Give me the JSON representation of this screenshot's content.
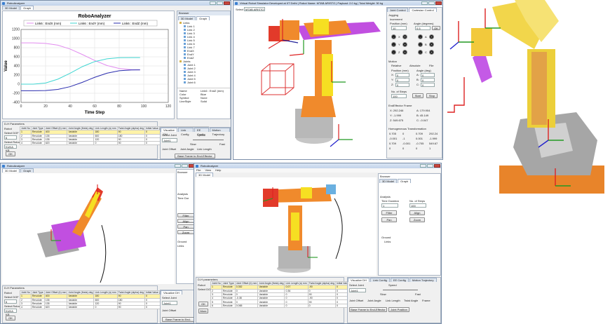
{
  "win1": {
    "title": "RoboAnalyzer",
    "tabs": [
      "3D Model",
      "Graph"
    ],
    "browser": {
      "title": "Browser",
      "tabs": [
        "3D Model",
        "Graph"
      ],
      "tree": [
        "Links",
        "Link 1",
        "Link 2",
        "Link 3",
        "Link 4",
        "Link 5",
        "Link 6",
        "Link 7",
        "EndX",
        "EndY",
        "EndZ",
        "Joints",
        "Joint 1",
        "Joint 2",
        "Joint 3",
        "Joint 4",
        "Joint 5",
        "Joint 6"
      ],
      "props": [
        [
          "Name",
          "Link6 : EndZ (mm)"
        ],
        [
          "Color",
          "Blue"
        ],
        [
          "Symbol",
          "None"
        ],
        [
          "LineStyle",
          "Solid"
        ]
      ]
    },
    "params": {
      "title": "D-H Parameters",
      "robot_label": "Robot",
      "select_dof_label": "Select DOF",
      "select_robot_label": "Select Robot",
      "robot_value": "KUKA KR",
      "dof_value": "6",
      "ok_label": "OK",
      "headers": [
        "Joint No",
        "Joint Type",
        "Joint Offset (b) mm",
        "Joint Angle (theta) deg",
        "Link Length (a) mm",
        "Twist Angle (alpha) deg",
        "Initial Value (JV) deg or mm",
        "Final Value (JV) deg or mm"
      ],
      "rows": [
        [
          "1",
          "Revolute",
          "400",
          "Variable",
          "180",
          "90",
          "0",
          "60"
        ],
        [
          "2",
          "Revolute",
          "135",
          "Variable",
          "600",
          "180",
          "0",
          "60"
        ],
        [
          "3",
          "Revolute",
          "135",
          "Variable",
          "120",
          "90",
          "0",
          "60"
        ],
        [
          "4",
          "Revolute",
          "620",
          "Variable",
          "0",
          "90",
          "0",
          "60"
        ]
      ]
    },
    "viz": {
      "tabs": [
        "Visualize DH",
        "Link Config",
        "EE Config",
        "Motion Trajectory"
      ],
      "select_joint": "Select Joint",
      "speed": "Speed",
      "joint_value": "Joint1",
      "slow": "Slow",
      "fast": "Fast",
      "cols": [
        "Joint Offset",
        "Joint Angle",
        "Link Length"
      ],
      "base_btn": "Base Frame to End-Effector"
    }
  },
  "chart_data": {
    "type": "line",
    "title": "RoboAnalyzer",
    "xlabel": "Time Step",
    "ylabel": "Value",
    "xlim": [
      0,
      120
    ],
    "ylim": [
      -400,
      1200
    ],
    "xticks": [
      0,
      20,
      40,
      60,
      80,
      100,
      120
    ],
    "yticks": [
      -400,
      -200,
      0,
      200,
      400,
      600,
      800,
      1000,
      1200
    ],
    "grid": true,
    "legend": "top",
    "x": [
      0,
      10,
      20,
      30,
      40,
      50,
      60,
      70,
      80,
      90,
      97
    ],
    "series": [
      {
        "name": "Link6 : EndX (mm)",
        "color": "#e28cf0",
        "values": [
          905,
          905,
          895,
          855,
          770,
          650,
          520,
          410,
          345,
          318,
          313
        ]
      },
      {
        "name": "Link6 : EndY (mm)",
        "color": "#40d6d2",
        "values": [
          0,
          0,
          25,
          110,
          240,
          385,
          495,
          555,
          580,
          583,
          583
        ]
      },
      {
        "name": "Link6 : EndZ (mm)",
        "color": "#2a2cae",
        "values": [
          -145,
          -145,
          -140,
          -115,
          -55,
          40,
          150,
          240,
          295,
          312,
          313
        ]
      }
    ]
  },
  "win2": {
    "title": "Virtual Robot Simulator Developed at IIT Delhi | Robot Name: MTAB ARISTO | Payload: 2.0 kg | Total Weight: 30 kg",
    "select_label": "Select",
    "robot_select": "MTAB ARISTO",
    "tabs": [
      "Joint Control",
      "Cartesian Control"
    ],
    "jogging": "Jogging",
    "increment": "Increment",
    "position_label": "Position (mm)",
    "angle_label": "Angle (degrees)",
    "pos_val": "10",
    "ang_val": "0.5",
    "ok": "OK",
    "axes_left": [
      "X",
      "Y",
      "Z"
    ],
    "axes_right": [
      "A",
      "B",
      "C"
    ],
    "motion": "Motion",
    "relative": "Relative",
    "absolute": "Absolute",
    "file": "File",
    "pos_mm": "Position (mm)",
    "angle_deg": "Angle (deg)",
    "fields": [
      "X",
      "Y",
      "Z"
    ],
    "field_vals": [
      "0",
      "0",
      "0"
    ],
    "fields_r": [
      "A",
      "B",
      "C"
    ],
    "nsteps_label": "No. of Steps",
    "nsteps": "100",
    "start": "Start",
    "stop": "Stop",
    "ee_frame": "EndEffector Frame",
    "ee": [
      [
        "X:",
        "292.246"
      ],
      [
        "A:",
        "179.904"
      ],
      [
        "Y:",
        "-1.999"
      ],
      [
        "B:",
        "45.149"
      ],
      [
        "Z:",
        "549.675"
      ],
      [
        "C:",
        "-0.047"
      ]
    ],
    "htm_label": "Homogeneous Transformation",
    "htm": [
      [
        "0.705",
        "0",
        "0.709",
        "292.24"
      ],
      [
        "-0.001",
        "-1",
        "0.001",
        "-1.999"
      ],
      [
        "0.709",
        "-0.001",
        "-0.705",
        "549.67"
      ],
      [
        "0",
        "0",
        "0",
        "1"
      ]
    ]
  },
  "win3": {
    "title": "RoboAnalyzer",
    "tabs": [
      "3D Model",
      "Graph"
    ],
    "browser": "Browser",
    "ground": "Ground",
    "links": "Links",
    "analysis": "Analysis",
    "time_label": "Time Dur",
    "filter": "Filter",
    "align": "Align",
    "pan": "Pan",
    "zoom": "Zoom",
    "params": {
      "title": "D-H Parameters",
      "robot_label": "Robot",
      "select_dof_label": "Select DOF",
      "select_robot_label": "Select Robot",
      "robot_value": "KUKA KR",
      "dof_value": "6",
      "ok_label": "OK",
      "headers": [
        "Joint No",
        "Joint Type",
        "Joint Offset (b) mm",
        "Joint Angle (theta) deg",
        "Link Length (a) mm",
        "Twist Angle (alpha) deg",
        "Initial Value (JV) deg or mm",
        "Final Value (JV) deg or mm"
      ],
      "rows": [
        [
          "1",
          "Revolute",
          "400",
          "Variable",
          "180",
          "90",
          "0",
          "60"
        ],
        [
          "2",
          "Revolute",
          "135",
          "Variable",
          "600",
          "180",
          "0",
          "60"
        ],
        [
          "3",
          "Revolute",
          "135",
          "Variable",
          "120",
          "90",
          "0",
          "60"
        ],
        [
          "4",
          "Revolute",
          "620",
          "Variable",
          "0",
          "90",
          "0",
          "60"
        ]
      ]
    },
    "viz_tabs": [
      "Visualize DH",
      "Link Config",
      "EE Config",
      "Motion Trajectory"
    ],
    "select_joint": "Select Joint",
    "joint_value": "Joint1",
    "cols": [
      "Joint Offset",
      "Joint Angle",
      "Link Length"
    ],
    "base_btn": "Base Frame to End-Effector"
  },
  "win4": {
    "title": "RoboAnalyzer",
    "menu": [
      "File",
      "View",
      "Help"
    ],
    "tabs": [
      "3D Model"
    ],
    "browser": "Browser",
    "browser_tabs": [
      "3D Model",
      "Graph"
    ],
    "analysis": "Analysis",
    "time_label": "Time Duration",
    "steps_label": "No. of Steps",
    "time_val": "1",
    "steps_val": "100",
    "filter": "Filter",
    "align": "Align",
    "pan": "Pan",
    "zoom": "Zoom",
    "ground": "Ground",
    "links": "Links",
    "params_title": "D-H parameters",
    "robot_label": "Robot",
    "select_dof": "Select DOF",
    "ok": "OK",
    "more": "More",
    "headers": [
      "Joint No",
      "Joint Type",
      "Joint Offset (b) mm",
      "Joint Angle (theta) deg",
      "Link Length (a) mm",
      "Twist Angle (alpha) deg",
      "Initial Value (JV)",
      "Final Value (JV)"
    ],
    "rows": [
      [
        "1",
        "Revolute",
        "0.352",
        "Variable",
        "0.07",
        "-90",
        "0",
        "60"
      ],
      [
        "2",
        "Revolute",
        "0",
        "Variable",
        "0.36",
        "0",
        "0",
        "60"
      ],
      [
        "3",
        "Revolute",
        "0",
        "Variable",
        "0",
        "90",
        "0",
        "60"
      ],
      [
        "4",
        "Revolute",
        "-0.38",
        "Variable",
        "0",
        "-90",
        "0",
        "60"
      ],
      [
        "5",
        "Revolute",
        "0",
        "Variable",
        "0",
        "90",
        "0",
        "60"
      ],
      [
        "6",
        "Revolute",
        "0.065",
        "Variable",
        "0",
        "0",
        "0",
        "60"
      ]
    ],
    "viz_tabs": [
      "Visualize DH",
      "Link Config",
      "EE Config",
      "Motion Trajectory"
    ],
    "select_joint": "Select Joint",
    "speed": "Speed",
    "joint_value": "Joint1",
    "slow": "Slow",
    "fast": "Fast",
    "cols": [
      "Joint Offset",
      "Joint Angle",
      "Link Length",
      "Twist Angle",
      "Frame"
    ],
    "btns": [
      "Base Frame to End-Effector",
      "Joint Position"
    ]
  },
  "colors": {
    "link_orange": "#f08a2c",
    "link_magenta": "#c14fe0",
    "link_yellow": "#f6df22",
    "link_red": "#e23a2a",
    "base_gray": "#a9a9a9"
  }
}
